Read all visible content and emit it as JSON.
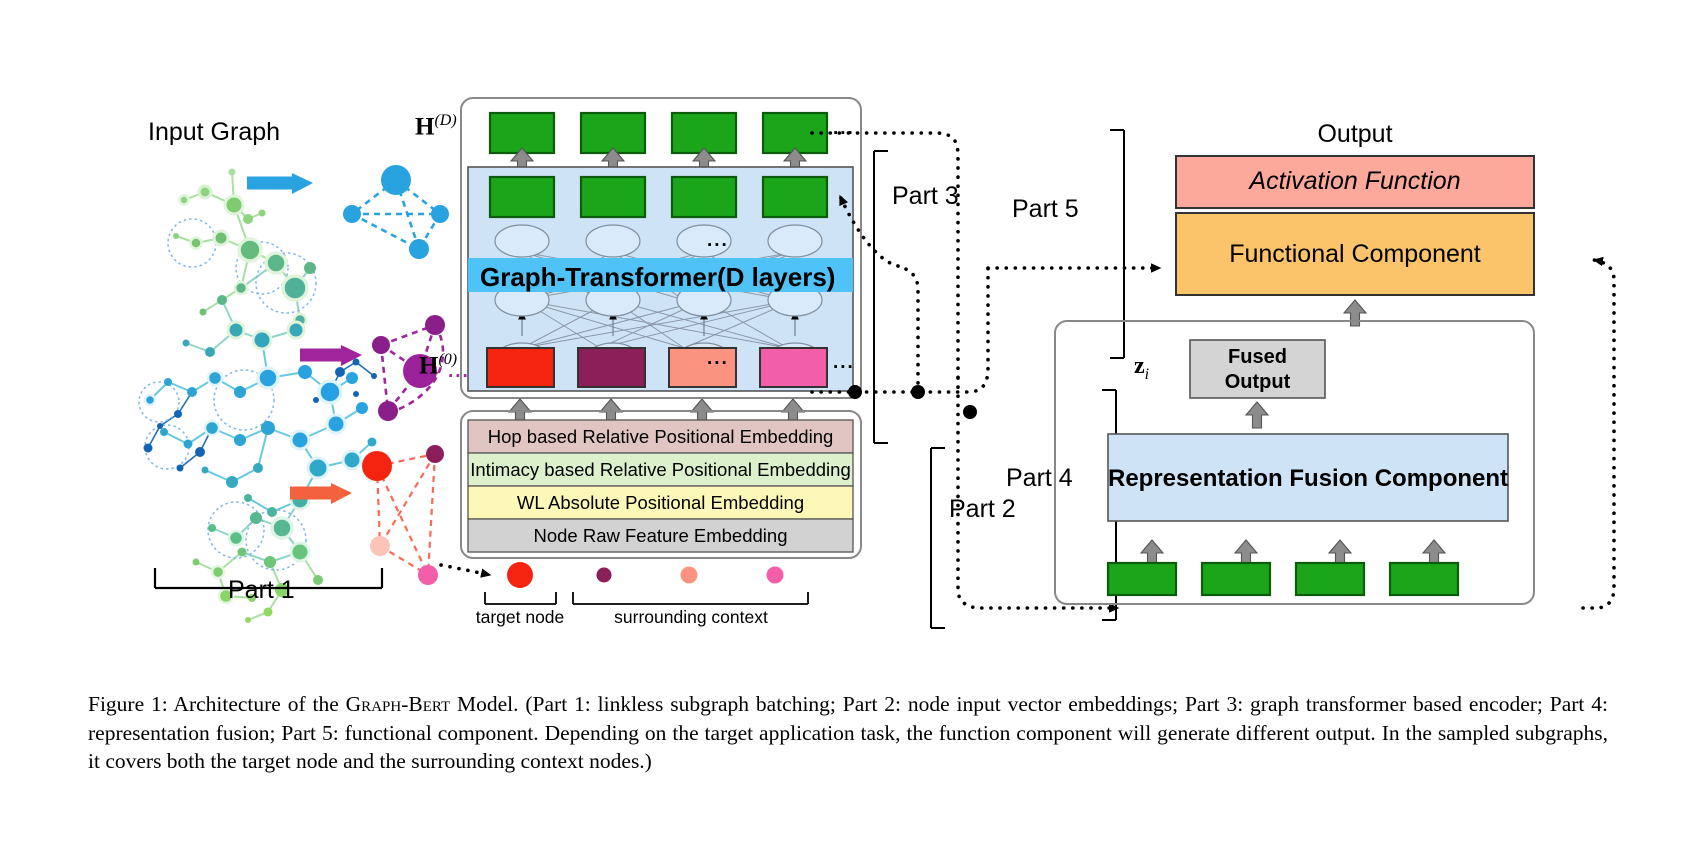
{
  "figure": {
    "caption_prefix": "Figure 1:",
    "caption_line": "Architecture of the GRAPH-BERT Model. (Part 1: linkless subgraph batching; Part 2: node input vector embeddings; Part 3: graph transformer based encoder; Part 4: representation fusion; Part 5: functional component. Depending on the target application task, the function component will generate different output. In the sampled subgraphs, it covers both the target node and the surrounding context nodes.)",
    "model_name": "Graph-Bert"
  },
  "left": {
    "input_graph_title": "Input Graph",
    "part1_label": "Part 1"
  },
  "encoder": {
    "h_top_label": "H(D)",
    "h_top_base": "H",
    "h_top_sup": "(D)",
    "h_bottom_base": "H",
    "h_bottom_sup": "(0)",
    "transformer_label": "Graph-Transformer(D layers)",
    "ellipsis": "...",
    "part3_label": "Part 3"
  },
  "embeddings": {
    "part2_label": "Part 2",
    "layers": [
      {
        "text": "Hop based Relative Positional Embedding",
        "color": "#e0c5c3"
      },
      {
        "text": "Intimacy based Relative Positional Embedding",
        "color": "#ddf0cc"
      },
      {
        "text": "WL Absolute Positional Embedding",
        "color": "#fcf8b8"
      },
      {
        "text": "Node Raw Feature Embedding",
        "color": "#d2d2d2"
      }
    ],
    "node_legend": {
      "target_label": "target node",
      "context_label": "surrounding context",
      "target_color": "#f42410",
      "context_colors": [
        "#8c1e5a",
        "#fa9481",
        "#f25fa8"
      ]
    }
  },
  "right": {
    "output_label": "Output",
    "part5_label": "Part 5",
    "part4_label": "Part 4",
    "activation_label": "Activation Function",
    "functional_label": "Functional Component",
    "fused_output_line1": "Fused",
    "fused_output_line2": "Output",
    "z_base": "z",
    "z_sub": "i",
    "fusion_label": "Representation Fusion Component"
  },
  "colors": {
    "green_block": "#1aa51a",
    "green_block_border": "#0c5c0c",
    "panel_blue": "#cfe3f7",
    "transformer_highlight": "#4fc3f7",
    "activation_pink": "#fca99b",
    "functional_orange": "#fcc46a",
    "fusion_blue": "#cfe3f7",
    "fused_gray": "#d4d4d4",
    "arrow_gray": "#8c8c8c",
    "arrow_gray_border": "#555555",
    "h0_red": "#f42410",
    "h0_purple": "#8c1e5a",
    "h0_salmon": "#fa9481",
    "h0_pink": "#f25fa8",
    "graph_blue": "#29a3e0",
    "graph_purple": "#a0249c",
    "graph_orange": "#f4613f"
  }
}
